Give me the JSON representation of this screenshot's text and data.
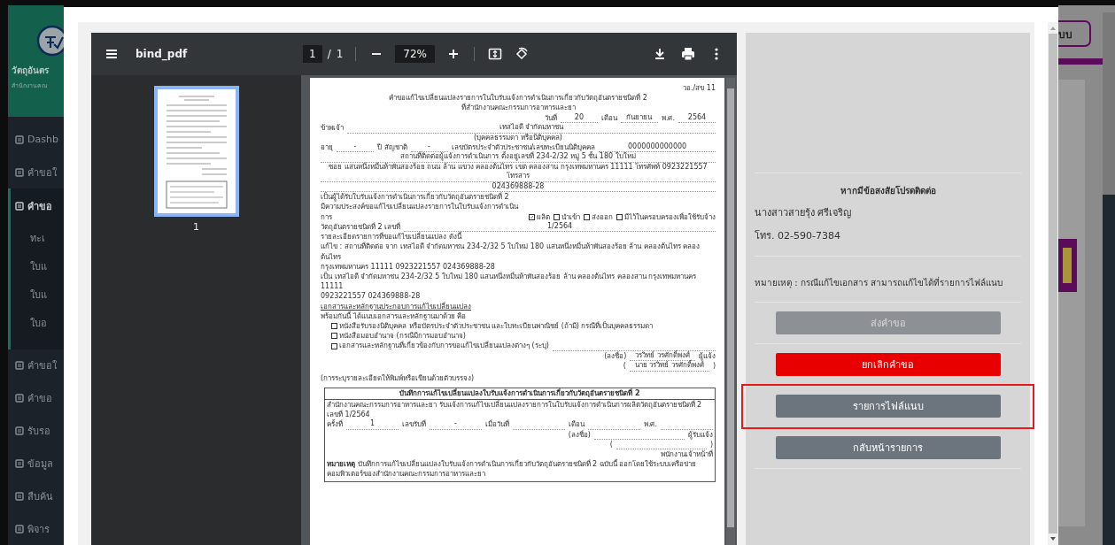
{
  "sidebar": {
    "brand": {
      "title": "วัตถุอันตร",
      "subtitle": "สำนักงานคณ"
    },
    "items": [
      {
        "label": "Dashb",
        "selected": false
      },
      {
        "label": "คำขอใ",
        "selected": false
      },
      {
        "label": "คำขอ",
        "selected": true,
        "children": [
          {
            "label": "ทะเ"
          },
          {
            "label": "ใบแ"
          },
          {
            "label": "ใบแ"
          },
          {
            "label": "ใบอ"
          }
        ]
      },
      {
        "label": "คำขอใ",
        "selected": false
      },
      {
        "label": "คำขอ",
        "selected": false
      },
      {
        "label": "รับรอ",
        "selected": false
      },
      {
        "label": "ข้อมูล",
        "selected": false
      },
      {
        "label": "สืบค้น",
        "selected": false
      },
      {
        "label": "พิจาร",
        "selected": false
      }
    ]
  },
  "viewer": {
    "file_name": "bind_pdf",
    "page": "1",
    "page_separator": "/",
    "page_count": "1",
    "zoom": "72%",
    "thumbnails": [
      {
        "label": "1",
        "selected": true
      }
    ]
  },
  "document": {
    "lines": [
      {
        "kind": "row_right",
        "parts": [
          {
            "kind": "text",
            "text": "วอ./สข 11"
          }
        ]
      },
      {
        "kind": "title",
        "text": "คำขอแก้ไขเปลี่ยนแปลงรายการในใบรับแจ้งการดำเนินการเกี่ยวกับวัตถุอันตรายชนิดที่ 2"
      },
      {
        "kind": "title",
        "text": "ที่สำนักงานคณะกรรมการอาหารและยา"
      },
      {
        "kind": "row_right",
        "parts": [
          {
            "kind": "text",
            "text": "วันที่"
          },
          {
            "kind": "short_value",
            "text": "20"
          },
          {
            "kind": "text",
            "text": "เดือน"
          },
          {
            "kind": "short_value",
            "text": "กันยายน"
          },
          {
            "kind": "text",
            "text": "พ.ศ."
          },
          {
            "kind": "short_value",
            "text": "2564"
          }
        ]
      },
      {
        "kind": "row",
        "parts": [
          {
            "kind": "text",
            "text": "ข้าพเจ้า"
          },
          {
            "kind": "value",
            "text": "เทสไอดี จำกัดมหาชน"
          }
        ]
      },
      {
        "kind": "caption",
        "text": "(บุคคลธรรมดา หรือนิติบุคคล)"
      },
      {
        "kind": "row",
        "parts": [
          {
            "kind": "text",
            "text": "อายุ"
          },
          {
            "kind": "short_value",
            "text": "-"
          },
          {
            "kind": "text",
            "text": "ปี สัญชาติ"
          },
          {
            "kind": "short_value",
            "text": "-"
          },
          {
            "kind": "text",
            "text": "เลขบัตรประจำตัวประชาชน/เลขทะเบียนนิติบุคคล"
          },
          {
            "kind": "value",
            "text": "0000000000000"
          }
        ]
      },
      {
        "kind": "row",
        "parts": [
          {
            "kind": "value",
            "text": "สถานที่ติดต่อผู้แจ้งการดำเนินการ ตั้งอยู่เลขที่ 234-2/32 หมู่ 5 ชั้น 180 ใบใหม่"
          }
        ]
      },
      {
        "kind": "row",
        "parts": [
          {
            "kind": "value",
            "text": "ซอย แสนหนึ่งหมื่นห้าพันสองร้อย ถนน ล้าน แขวง คลองต้นไทร เขต คลองสาน กรุงเทพมหานคร 11111 โทรศัพท์ 0923221557 โทรสาร"
          }
        ]
      },
      {
        "kind": "row",
        "parts": [
          {
            "kind": "value",
            "text": "024369888-28"
          }
        ]
      },
      {
        "kind": "row",
        "parts": [
          {
            "kind": "text",
            "text": "เป็นผู้ได้รับใบรับแจ้งการดำเนินการเกี่ยวกับวัตถุอันตรายชนิดที่ 2"
          }
        ]
      },
      {
        "kind": "row",
        "parts": [
          {
            "kind": "text",
            "text": "มีความประสงค์ขอแก้ไขเปลี่ยนแปลงรายการในใบรับแจ้งการดำเนินการ"
          },
          {
            "kind": "check",
            "text": "ผลิต",
            "checked": true
          },
          {
            "kind": "check",
            "text": "นำเข้า",
            "checked": false
          },
          {
            "kind": "check",
            "text": "ส่งออก",
            "checked": false
          },
          {
            "kind": "check",
            "text": "มีไว้ในครอบครองเพื่อใช้รับจ้าง",
            "checked": false
          }
        ]
      },
      {
        "kind": "row",
        "parts": [
          {
            "kind": "text",
            "text": "วัตถุอันตรายชนิดที่ 2 เลขที่"
          },
          {
            "kind": "value",
            "text": "1/2564"
          }
        ]
      },
      {
        "kind": "row",
        "parts": [
          {
            "kind": "text",
            "text": "รายละเอียดรายการที่ขอแก้ไขเปลี่ยนแปลง ดังนี้"
          }
        ]
      },
      {
        "kind": "row",
        "parts": [
          {
            "kind": "text",
            "text": "แก้ไข : สถานที่ติดต่อ จาก เทสไอดี จำกัดมหาชน 234-2/32 5 ใบใหม่ 180 แสนหนึ่งหมื่นห้าพันสองร้อย ล้าน คลองต้นไทร คลองต้นไทร"
          }
        ]
      },
      {
        "kind": "row",
        "parts": [
          {
            "kind": "text",
            "text": "กรุงเทพมหานคร 11111 0923221557 024369888-28"
          }
        ]
      },
      {
        "kind": "row",
        "parts": [
          {
            "kind": "text",
            "text": "เป็น เทสไอดี จำกัดมหาชน 234-2/32 5 ใบใหม่ 180 แสนหนึ่งหมื่นห้าพันสองร้อย ล้าน คลองต้นไทร คลองสาน กรุงเทพมหานคร 11111"
          }
        ]
      },
      {
        "kind": "row",
        "parts": [
          {
            "kind": "text",
            "text": "0923221557 024369888-28"
          }
        ]
      },
      {
        "kind": "heading",
        "text": "เอกสารและหลักฐานประกอบการแก้ไขเปลี่ยนแปลง"
      },
      {
        "kind": "row",
        "parts": [
          {
            "kind": "text",
            "text": "พร้อมกันนี้ ได้แนบเอกสารและหลักฐานมาด้วย คือ"
          }
        ]
      },
      {
        "kind": "row_indent",
        "parts": [
          {
            "kind": "check",
            "text": "หนังสือรับรองนิติบุคคล หรือบัตรประจำตัวประชาชน และใบทะเบียนพาณิชย์ (ถ้ามี) กรณีที่เป็นบุคคลธรรมดา",
            "checked": false
          }
        ]
      },
      {
        "kind": "row_indent",
        "parts": [
          {
            "kind": "check",
            "text": "หนังสือมอบอำนาจ (กรณีมีการมอบอำนาจ)",
            "checked": false
          }
        ]
      },
      {
        "kind": "row_indent",
        "parts": [
          {
            "kind": "check",
            "text": "เอกสารและหลักฐานที่เกี่ยวข้องกับการขอแก้ไขเปลี่ยนแปลงต่างๆ (ระบุ)",
            "checked": false
          },
          {
            "kind": "blank"
          }
        ]
      },
      {
        "kind": "row_right",
        "parts": [
          {
            "kind": "text",
            "text": "(ลงชื่อ)"
          },
          {
            "kind": "short_value",
            "text": "วรวิทย์ วรศักดิ์พงศ์"
          },
          {
            "kind": "text",
            "text": "ผู้แจ้ง"
          }
        ]
      },
      {
        "kind": "row_right",
        "parts": [
          {
            "kind": "text",
            "text": "("
          },
          {
            "kind": "short_value",
            "text": "นาย วรวิทย์ วรศักดิ์พงศ์"
          },
          {
            "kind": "text",
            "text": ")"
          }
        ]
      },
      {
        "kind": "caption_left",
        "text": "(การระบุรายละเอียดให้พิมพ์หรือเขียนด้วยตัวบรรจง)"
      }
    ],
    "record": {
      "title": "บันทึกการแก้ไขเปลี่ยนแปลงใบรับแจ้งการดำเนินการเกี่ยวกับวัตถุอันตรายชนิดที่ 2",
      "lines": [
        {
          "kind": "row",
          "parts": [
            {
              "kind": "text",
              "text": "สำนักงานคณะกรรมการอาหารและยา รับแจ้งการแก้ไขเปลี่ยนแปลงรายการในใบรับแจ้งการดำเนินการผลิตวัตถุอันตรายชนิดที่ 2"
            }
          ]
        },
        {
          "kind": "row",
          "parts": [
            {
              "kind": "text",
              "text": "เลขที่ 1/2564"
            }
          ]
        },
        {
          "kind": "row",
          "parts": [
            {
              "kind": "text",
              "text": "ครั้งที่"
            },
            {
              "kind": "value",
              "text": "1"
            },
            {
              "kind": "text",
              "text": "เลขรับที่"
            },
            {
              "kind": "value",
              "text": "-"
            },
            {
              "kind": "text",
              "text": "เมื่อวันที่"
            },
            {
              "kind": "blank"
            },
            {
              "kind": "text",
              "text": "เดือน"
            },
            {
              "kind": "blank"
            },
            {
              "kind": "text",
              "text": "พ.ศ."
            },
            {
              "kind": "blank"
            }
          ]
        },
        {
          "kind": "row_right",
          "parts": [
            {
              "kind": "text",
              "text": "(ลงชื่อ)"
            },
            {
              "kind": "short_blank"
            },
            {
              "kind": "text",
              "text": "ผู้รับแจ้ง"
            }
          ]
        },
        {
          "kind": "row_right",
          "parts": [
            {
              "kind": "text",
              "text": "("
            },
            {
              "kind": "short_blank"
            },
            {
              "kind": "text",
              "text": ")"
            }
          ]
        },
        {
          "kind": "row_right",
          "parts": [
            {
              "kind": "text",
              "text": "พนักงานเจ้าหน้าที่"
            }
          ]
        },
        {
          "kind": "row",
          "parts": [
            {
              "kind": "text",
              "text": "**หมายเหตุ** บันทึกการแก้ไขเปลี่ยนแปลงใบรับแจ้งการดำเนินการเกี่ยวกับวัตถุอันตรายชนิดที่ 2 ฉบับนี้ ออกโดยใช้ระบบเครือข่ายคอมพิวเตอร์ของสำนักงานคณะกรรมการอาหารและยา"
            }
          ]
        }
      ]
    }
  },
  "panel": {
    "heading": "หากมีข้อสงสัยโปรดติดต่อ",
    "contact_name": "นางสาวสายรุ้ง ศรีเจริญ",
    "phone": "โทร. 02-590-7384",
    "note": "หมายเหตุ : กรณีแก้ไขเอกสาร สามารถแก้ไขได้ที่รายการไฟล์แนบ",
    "buttons": [
      {
        "label": "ส่งคำขอ",
        "kind": "disabled",
        "highlighted": false
      },
      {
        "label": "ยกเลิกคำขอ",
        "kind": "danger",
        "highlighted": false
      },
      {
        "label": "รายการไฟล์แนบ",
        "kind": "secondary",
        "highlighted": true
      },
      {
        "label": "กลับหน้ารายการ",
        "kind": "secondary",
        "highlighted": false
      }
    ]
  },
  "background": {
    "button": "บบ"
  }
}
